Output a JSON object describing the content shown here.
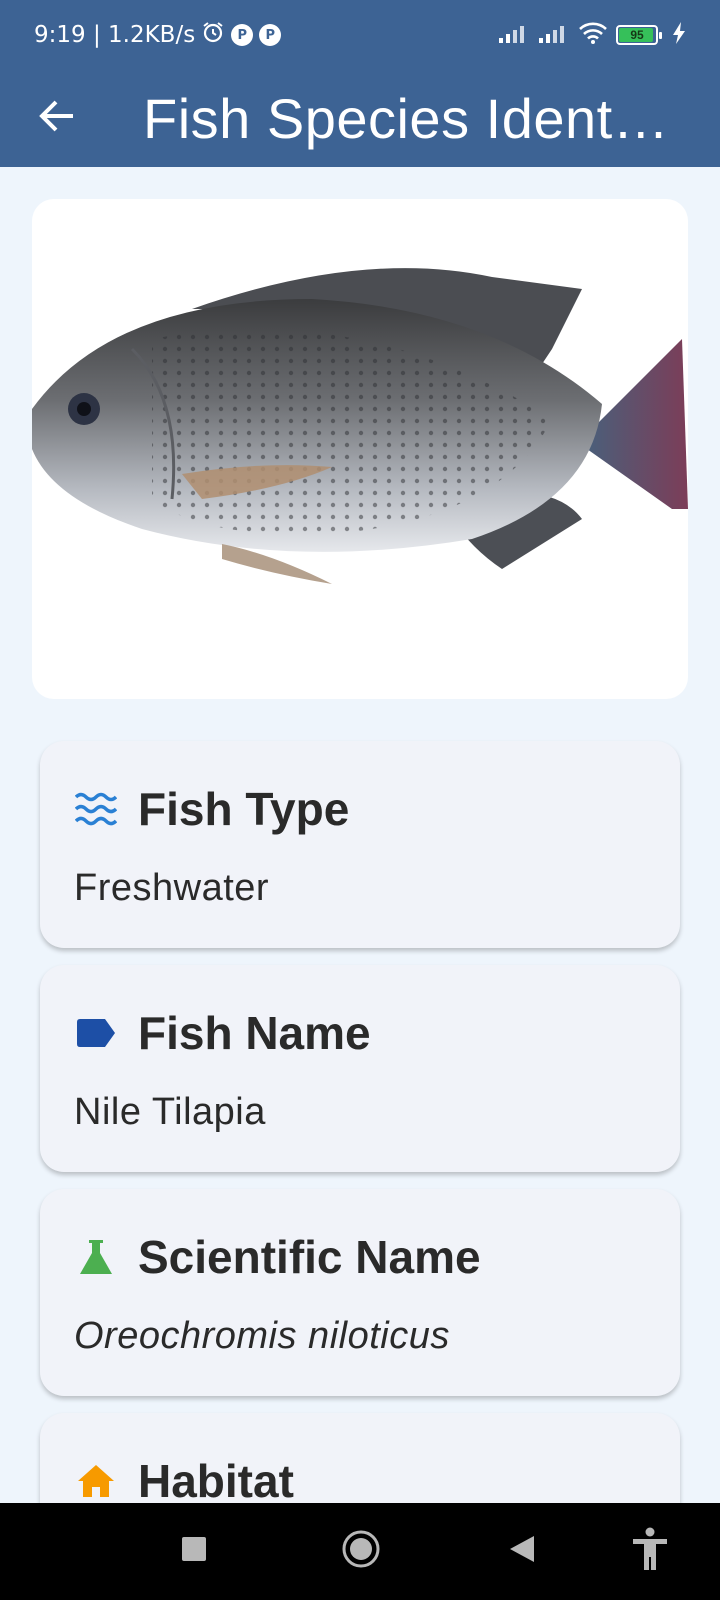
{
  "status_bar": {
    "time_speed": "9:19 | 1.2KB/s",
    "battery_level": "95",
    "icons": [
      "alarm-icon",
      "p-icon",
      "p-icon",
      "signal-icon",
      "signal-icon",
      "wifi-icon",
      "battery-icon",
      "charging-icon"
    ]
  },
  "header": {
    "title": "Fish Species Identi...",
    "back_icon": "arrow-left-icon",
    "background": "#3d6394"
  },
  "fish_image": {
    "icon": "fish-photo"
  },
  "cards": [
    {
      "icon": "waves-icon",
      "icon_color": "#2a80d4",
      "title": "Fish Type",
      "value": "Freshwater"
    },
    {
      "icon": "label-icon",
      "icon_color": "#1d4fa6",
      "title": "Fish Name",
      "value": "Nile Tilapia"
    },
    {
      "icon": "flask-icon",
      "icon_color": "#4caf50",
      "title": "Scientific Name",
      "value": "Oreochromis niloticus"
    },
    {
      "icon": "home-icon",
      "icon_color": "#f79a00",
      "title": "Habitat",
      "value": ""
    }
  ],
  "nav_bar": {
    "buttons": [
      "recents-icon",
      "home-circle-icon",
      "back-triangle-icon",
      "accessibility-icon"
    ]
  },
  "colors": {
    "page_background": "#eef5fc",
    "card_background": "#f1f3f9"
  }
}
